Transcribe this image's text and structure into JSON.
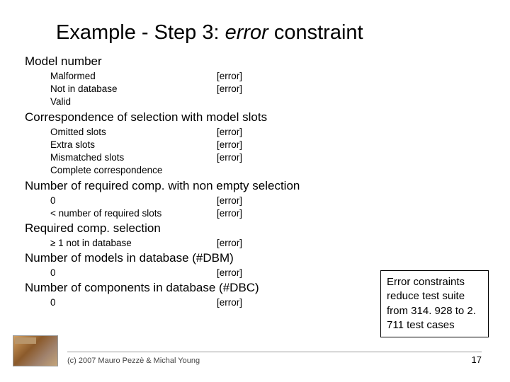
{
  "title_left": "Example - Step 3: ",
  "title_italic": "error",
  "title_right": " constraint",
  "sections": [
    {
      "heading": "Model number",
      "rows": [
        {
          "label": "Malformed",
          "err": "[error]"
        },
        {
          "label": "Not in database",
          "err": "[error]"
        },
        {
          "label": "Valid",
          "err": ""
        }
      ]
    },
    {
      "heading": "Correspondence of selection with model slots",
      "rows": [
        {
          "label": "Omitted slots",
          "err": "[error]"
        },
        {
          "label": "Extra slots",
          "err": "[error]"
        },
        {
          "label": "Mismatched slots",
          "err": "[error]"
        },
        {
          "label": "Complete correspondence",
          "err": ""
        }
      ]
    },
    {
      "heading": "Number of required comp. with non empty selection",
      "rows": [
        {
          "label": "0",
          "err": "[error]"
        },
        {
          "label": "< number of required slots",
          "err": "[error]"
        }
      ]
    },
    {
      "heading": "Required comp. selection",
      "rows": [
        {
          "label": "≥ 1 not in database",
          "err": "[error]"
        }
      ]
    },
    {
      "heading": "Number of models in database (#DBM)",
      "rows": [
        {
          "label": "0",
          "err": "[error]"
        }
      ]
    },
    {
      "heading": "Number of components in database (#DBC)",
      "rows": [
        {
          "label": "0",
          "err": "[error]"
        }
      ]
    }
  ],
  "callout": "Error constraints reduce test suite from 314. 928 to 2. 711 test cases",
  "copyright": "(c) 2007 Mauro Pezzè & Michal Young",
  "pagenum": "17"
}
